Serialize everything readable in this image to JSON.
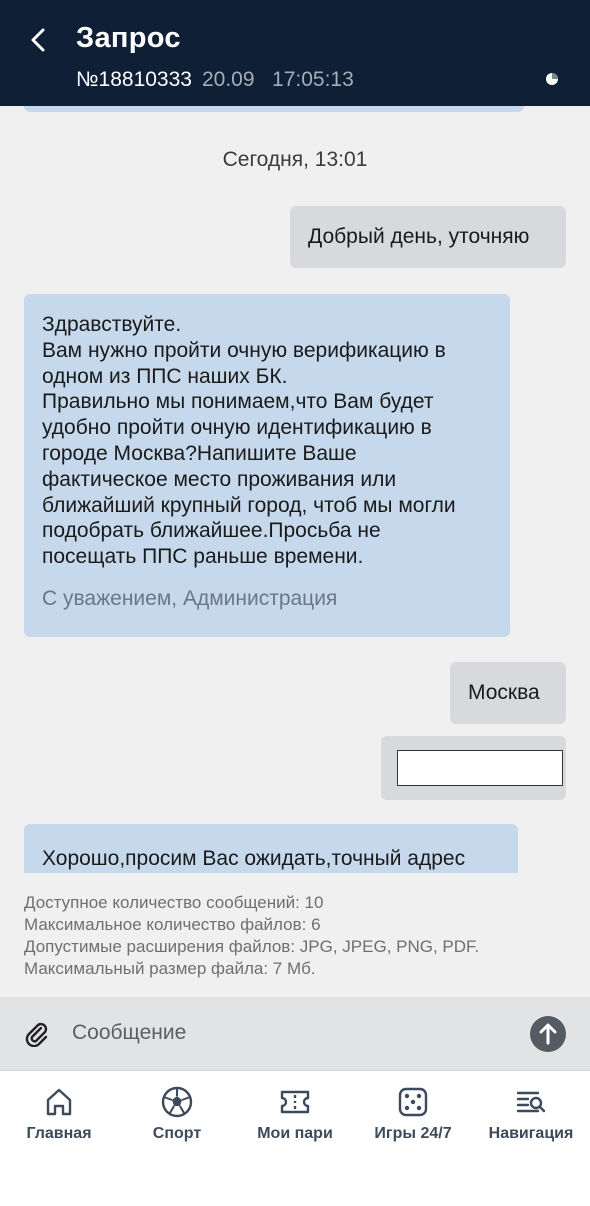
{
  "header": {
    "title": "Запрос",
    "request_number": "№18810333",
    "datetime": "20.09   17:05:13"
  },
  "chat": {
    "date_separator": "Сегодня, 13:01",
    "messages": [
      {
        "direction": "out",
        "text": "Добрый день, уточняю"
      },
      {
        "direction": "in",
        "lines": [
          "Здравствуйте.",
          "Вам нужно пройти очную верификацию в",
          "одном из ППС наших БК.",
          "Правильно мы понимаем,что Вам будет",
          "удобно пройти очную идентификацию в",
          "городе Москва?Напишите Ваше",
          "фактическое место проживания или",
          "ближайший крупный город, чтоб мы могли",
          "подобрать ближайшее.Просьба не",
          "посещать ППС раньше времени."
        ],
        "signature": "С уважением, Администрация"
      },
      {
        "direction": "out",
        "text": "Москва"
      },
      {
        "direction": "out",
        "type": "attachment"
      },
      {
        "direction": "in",
        "text": "Хорошо,просим Вас ожидать,точный адрес"
      }
    ]
  },
  "limits": {
    "messages": "Доступное количество сообщений: 10",
    "files": "Максимальное количество файлов: 6",
    "extensions": "Допустимые расширения файлов: JPG, JPEG, PNG, PDF.",
    "size": "Максимальный размер файла: 7 Мб."
  },
  "composer": {
    "placeholder": "Сообщение",
    "attach_icon": "paperclip-icon",
    "send_icon": "arrow-up-icon"
  },
  "tabbar": {
    "items": [
      {
        "label": "Главная",
        "icon": "home-icon"
      },
      {
        "label": "Спорт",
        "icon": "soccer-ball-icon"
      },
      {
        "label": "Мои пари",
        "icon": "ticket-icon"
      },
      {
        "label": "Игры 24/7",
        "icon": "dice-icon"
      },
      {
        "label": "Навигация",
        "icon": "menu-search-icon"
      }
    ]
  },
  "colors": {
    "header_bg": "#0f2036",
    "incoming_bubble": "#c6d9ec",
    "outgoing_bubble": "#d7d9dc",
    "send_button": "#555b63",
    "tab_label": "#3c4a5c"
  }
}
